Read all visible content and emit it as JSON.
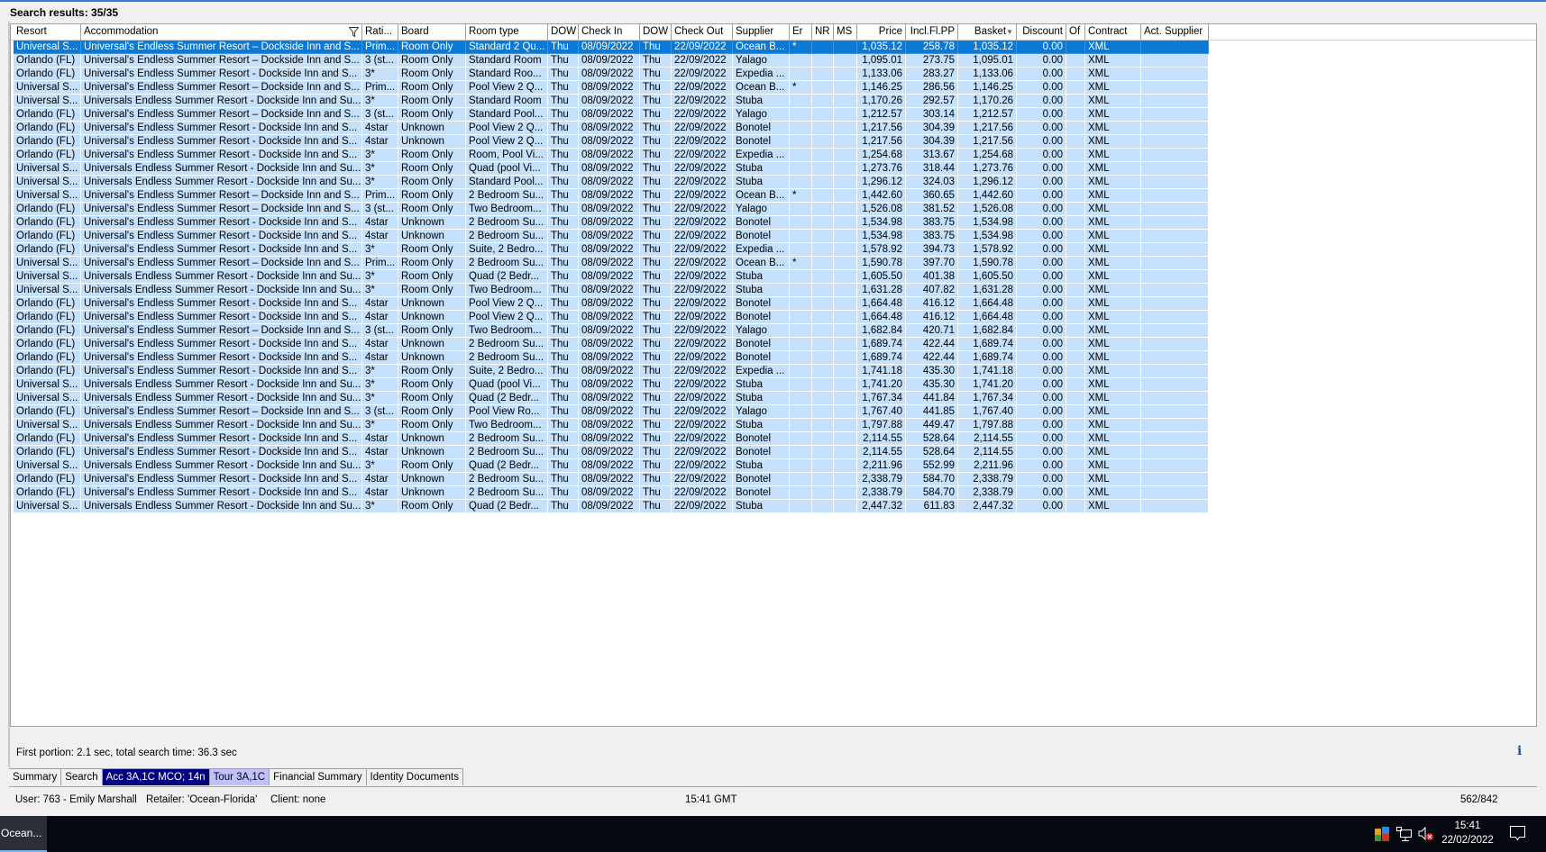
{
  "title": "Search results: 35/35",
  "columns": [
    "Resort",
    "Accommodation",
    "Rati...",
    "Board",
    "Room type",
    "DOW",
    "Check In",
    "DOW",
    "Check Out",
    "Supplier",
    "Er",
    "NR",
    "MS",
    "Price",
    "Incl.Fl.PP",
    "Basket",
    "Discount",
    "Of",
    "Contract",
    "Act. Supplier"
  ],
  "rows": [
    [
      "Universal S...",
      "Universal's Endless Summer Resort – Dockside Inn and S...",
      "Prim...",
      "Room Only",
      "Standard 2 Qu...",
      "Thu",
      "08/09/2022",
      "Thu",
      "22/09/2022",
      "Ocean B...",
      "*",
      "",
      "",
      "1,035.12",
      "258.78",
      "1,035.12",
      "0.00",
      "",
      "XML",
      ""
    ],
    [
      "Orlando (FL)",
      "Universal's Endless Summer Resort – Dockside Inn and S...",
      "3 (st...",
      "Room Only",
      "Standard Room",
      "Thu",
      "08/09/2022",
      "Thu",
      "22/09/2022",
      "Yalago",
      "",
      "",
      "",
      "1,095.01",
      "273.75",
      "1,095.01",
      "0.00",
      "",
      "XML",
      ""
    ],
    [
      "Orlando (FL)",
      "Universal's Endless Summer Resort - Dockside Inn and S...",
      "3*",
      "Room Only",
      "Standard Roo...",
      "Thu",
      "08/09/2022",
      "Thu",
      "22/09/2022",
      "Expedia ...",
      "",
      "",
      "",
      "1,133.06",
      "283.27",
      "1,133.06",
      "0.00",
      "",
      "XML",
      ""
    ],
    [
      "Universal S...",
      "Universal's Endless Summer Resort – Dockside Inn and S...",
      "Prim...",
      "Room Only",
      "Pool View 2 Q...",
      "Thu",
      "08/09/2022",
      "Thu",
      "22/09/2022",
      "Ocean B...",
      "*",
      "",
      "",
      "1,146.25",
      "286.56",
      "1,146.25",
      "0.00",
      "",
      "XML",
      ""
    ],
    [
      "Universal S...",
      "Universals Endless Summer Resort - Dockside Inn and Su...",
      "3*",
      "Room Only",
      "Standard Room",
      "Thu",
      "08/09/2022",
      "Thu",
      "22/09/2022",
      "Stuba",
      "",
      "",
      "",
      "1,170.26",
      "292.57",
      "1,170.26",
      "0.00",
      "",
      "XML",
      ""
    ],
    [
      "Orlando (FL)",
      "Universal's Endless Summer Resort – Dockside Inn and S...",
      "3 (st...",
      "Room Only",
      "Standard Pool...",
      "Thu",
      "08/09/2022",
      "Thu",
      "22/09/2022",
      "Yalago",
      "",
      "",
      "",
      "1,212.57",
      "303.14",
      "1,212.57",
      "0.00",
      "",
      "XML",
      ""
    ],
    [
      "Orlando (FL)",
      "Universal's Endless Summer Resort - Dockside Inn and S...",
      "4star",
      "Unknown",
      "Pool View 2 Q...",
      "Thu",
      "08/09/2022",
      "Thu",
      "22/09/2022",
      "Bonotel",
      "",
      "",
      "",
      "1,217.56",
      "304.39",
      "1,217.56",
      "0.00",
      "",
      "XML",
      ""
    ],
    [
      "Orlando (FL)",
      "Universal's Endless Summer Resort - Dockside Inn and S...",
      "4star",
      "Unknown",
      "Pool View 2 Q...",
      "Thu",
      "08/09/2022",
      "Thu",
      "22/09/2022",
      "Bonotel",
      "",
      "",
      "",
      "1,217.56",
      "304.39",
      "1,217.56",
      "0.00",
      "",
      "XML",
      ""
    ],
    [
      "Orlando (FL)",
      "Universal's Endless Summer Resort - Dockside Inn and S...",
      "3*",
      "Room Only",
      "Room, Pool Vi...",
      "Thu",
      "08/09/2022",
      "Thu",
      "22/09/2022",
      "Expedia ...",
      "",
      "",
      "",
      "1,254.68",
      "313.67",
      "1,254.68",
      "0.00",
      "",
      "XML",
      ""
    ],
    [
      "Universal S...",
      "Universals Endless Summer Resort - Dockside Inn and Su...",
      "3*",
      "Room Only",
      "Quad (pool Vi...",
      "Thu",
      "08/09/2022",
      "Thu",
      "22/09/2022",
      "Stuba",
      "",
      "",
      "",
      "1,273.76",
      "318.44",
      "1,273.76",
      "0.00",
      "",
      "XML",
      ""
    ],
    [
      "Universal S...",
      "Universals Endless Summer Resort - Dockside Inn and Su...",
      "3*",
      "Room Only",
      "Standard Pool...",
      "Thu",
      "08/09/2022",
      "Thu",
      "22/09/2022",
      "Stuba",
      "",
      "",
      "",
      "1,296.12",
      "324.03",
      "1,296.12",
      "0.00",
      "",
      "XML",
      ""
    ],
    [
      "Universal S...",
      "Universal's Endless Summer Resort – Dockside Inn and S...",
      "Prim...",
      "Room Only",
      "2 Bedroom Su...",
      "Thu",
      "08/09/2022",
      "Thu",
      "22/09/2022",
      "Ocean B...",
      "*",
      "",
      "",
      "1,442.60",
      "360.65",
      "1,442.60",
      "0.00",
      "",
      "XML",
      ""
    ],
    [
      "Orlando (FL)",
      "Universal's Endless Summer Resort – Dockside Inn and S...",
      "3 (st...",
      "Room Only",
      "Two Bedroom...",
      "Thu",
      "08/09/2022",
      "Thu",
      "22/09/2022",
      "Yalago",
      "",
      "",
      "",
      "1,526.08",
      "381.52",
      "1,526.08",
      "0.00",
      "",
      "XML",
      ""
    ],
    [
      "Orlando (FL)",
      "Universal's Endless Summer Resort - Dockside Inn and S...",
      "4star",
      "Unknown",
      "2 Bedroom Su...",
      "Thu",
      "08/09/2022",
      "Thu",
      "22/09/2022",
      "Bonotel",
      "",
      "",
      "",
      "1,534.98",
      "383.75",
      "1,534.98",
      "0.00",
      "",
      "XML",
      ""
    ],
    [
      "Orlando (FL)",
      "Universal's Endless Summer Resort - Dockside Inn and S...",
      "4star",
      "Unknown",
      "2 Bedroom Su...",
      "Thu",
      "08/09/2022",
      "Thu",
      "22/09/2022",
      "Bonotel",
      "",
      "",
      "",
      "1,534.98",
      "383.75",
      "1,534.98",
      "0.00",
      "",
      "XML",
      ""
    ],
    [
      "Orlando (FL)",
      "Universal's Endless Summer Resort - Dockside Inn and S...",
      "3*",
      "Room Only",
      "Suite, 2 Bedro...",
      "Thu",
      "08/09/2022",
      "Thu",
      "22/09/2022",
      "Expedia ...",
      "",
      "",
      "",
      "1,578.92",
      "394.73",
      "1,578.92",
      "0.00",
      "",
      "XML",
      ""
    ],
    [
      "Universal S...",
      "Universal's Endless Summer Resort – Dockside Inn and S...",
      "Prim...",
      "Room Only",
      "2 Bedroom Su...",
      "Thu",
      "08/09/2022",
      "Thu",
      "22/09/2022",
      "Ocean B...",
      "*",
      "",
      "",
      "1,590.78",
      "397.70",
      "1,590.78",
      "0.00",
      "",
      "XML",
      ""
    ],
    [
      "Universal S...",
      "Universals Endless Summer Resort - Dockside Inn and Su...",
      "3*",
      "Room Only",
      "Quad (2 Bedr...",
      "Thu",
      "08/09/2022",
      "Thu",
      "22/09/2022",
      "Stuba",
      "",
      "",
      "",
      "1,605.50",
      "401.38",
      "1,605.50",
      "0.00",
      "",
      "XML",
      ""
    ],
    [
      "Universal S...",
      "Universals Endless Summer Resort - Dockside Inn and Su...",
      "3*",
      "Room Only",
      "Two Bedroom...",
      "Thu",
      "08/09/2022",
      "Thu",
      "22/09/2022",
      "Stuba",
      "",
      "",
      "",
      "1,631.28",
      "407.82",
      "1,631.28",
      "0.00",
      "",
      "XML",
      ""
    ],
    [
      "Orlando (FL)",
      "Universal's Endless Summer Resort - Dockside Inn and S...",
      "4star",
      "Unknown",
      "Pool View 2 Q...",
      "Thu",
      "08/09/2022",
      "Thu",
      "22/09/2022",
      "Bonotel",
      "",
      "",
      "",
      "1,664.48",
      "416.12",
      "1,664.48",
      "0.00",
      "",
      "XML",
      ""
    ],
    [
      "Orlando (FL)",
      "Universal's Endless Summer Resort - Dockside Inn and S...",
      "4star",
      "Unknown",
      "Pool View 2 Q...",
      "Thu",
      "08/09/2022",
      "Thu",
      "22/09/2022",
      "Bonotel",
      "",
      "",
      "",
      "1,664.48",
      "416.12",
      "1,664.48",
      "0.00",
      "",
      "XML",
      ""
    ],
    [
      "Orlando (FL)",
      "Universal's Endless Summer Resort – Dockside Inn and S...",
      "3 (st...",
      "Room Only",
      "Two Bedroom...",
      "Thu",
      "08/09/2022",
      "Thu",
      "22/09/2022",
      "Yalago",
      "",
      "",
      "",
      "1,682.84",
      "420.71",
      "1,682.84",
      "0.00",
      "",
      "XML",
      ""
    ],
    [
      "Orlando (FL)",
      "Universal's Endless Summer Resort - Dockside Inn and S...",
      "4star",
      "Unknown",
      "2 Bedroom Su...",
      "Thu",
      "08/09/2022",
      "Thu",
      "22/09/2022",
      "Bonotel",
      "",
      "",
      "",
      "1,689.74",
      "422.44",
      "1,689.74",
      "0.00",
      "",
      "XML",
      ""
    ],
    [
      "Orlando (FL)",
      "Universal's Endless Summer Resort - Dockside Inn and S...",
      "4star",
      "Unknown",
      "2 Bedroom Su...",
      "Thu",
      "08/09/2022",
      "Thu",
      "22/09/2022",
      "Bonotel",
      "",
      "",
      "",
      "1,689.74",
      "422.44",
      "1,689.74",
      "0.00",
      "",
      "XML",
      ""
    ],
    [
      "Orlando (FL)",
      "Universal's Endless Summer Resort - Dockside Inn and S...",
      "3*",
      "Room Only",
      "Suite, 2 Bedro...",
      "Thu",
      "08/09/2022",
      "Thu",
      "22/09/2022",
      "Expedia ...",
      "",
      "",
      "",
      "1,741.18",
      "435.30",
      "1,741.18",
      "0.00",
      "",
      "XML",
      ""
    ],
    [
      "Universal S...",
      "Universals Endless Summer Resort - Dockside Inn and Su...",
      "3*",
      "Room Only",
      "Quad (pool Vi...",
      "Thu",
      "08/09/2022",
      "Thu",
      "22/09/2022",
      "Stuba",
      "",
      "",
      "",
      "1,741.20",
      "435.30",
      "1,741.20",
      "0.00",
      "",
      "XML",
      ""
    ],
    [
      "Universal S...",
      "Universals Endless Summer Resort - Dockside Inn and Su...",
      "3*",
      "Room Only",
      "Quad (2 Bedr...",
      "Thu",
      "08/09/2022",
      "Thu",
      "22/09/2022",
      "Stuba",
      "",
      "",
      "",
      "1,767.34",
      "441.84",
      "1,767.34",
      "0.00",
      "",
      "XML",
      ""
    ],
    [
      "Orlando (FL)",
      "Universal's Endless Summer Resort – Dockside Inn and S...",
      "3 (st...",
      "Room Only",
      "Pool View Ro...",
      "Thu",
      "08/09/2022",
      "Thu",
      "22/09/2022",
      "Yalago",
      "",
      "",
      "",
      "1,767.40",
      "441.85",
      "1,767.40",
      "0.00",
      "",
      "XML",
      ""
    ],
    [
      "Universal S...",
      "Universals Endless Summer Resort - Dockside Inn and Su...",
      "3*",
      "Room Only",
      "Two Bedroom...",
      "Thu",
      "08/09/2022",
      "Thu",
      "22/09/2022",
      "Stuba",
      "",
      "",
      "",
      "1,797.88",
      "449.47",
      "1,797.88",
      "0.00",
      "",
      "XML",
      ""
    ],
    [
      "Orlando (FL)",
      "Universal's Endless Summer Resort - Dockside Inn and S...",
      "4star",
      "Unknown",
      "2 Bedroom Su...",
      "Thu",
      "08/09/2022",
      "Thu",
      "22/09/2022",
      "Bonotel",
      "",
      "",
      "",
      "2,114.55",
      "528.64",
      "2,114.55",
      "0.00",
      "",
      "XML",
      ""
    ],
    [
      "Orlando (FL)",
      "Universal's Endless Summer Resort - Dockside Inn and S...",
      "4star",
      "Unknown",
      "2 Bedroom Su...",
      "Thu",
      "08/09/2022",
      "Thu",
      "22/09/2022",
      "Bonotel",
      "",
      "",
      "",
      "2,114.55",
      "528.64",
      "2,114.55",
      "0.00",
      "",
      "XML",
      ""
    ],
    [
      "Universal S...",
      "Universals Endless Summer Resort - Dockside Inn and Su...",
      "3*",
      "Room Only",
      "Quad (2 Bedr...",
      "Thu",
      "08/09/2022",
      "Thu",
      "22/09/2022",
      "Stuba",
      "",
      "",
      "",
      "2,211.96",
      "552.99",
      "2,211.96",
      "0.00",
      "",
      "XML",
      ""
    ],
    [
      "Orlando (FL)",
      "Universal's Endless Summer Resort - Dockside Inn and S...",
      "4star",
      "Unknown",
      "2 Bedroom Su...",
      "Thu",
      "08/09/2022",
      "Thu",
      "22/09/2022",
      "Bonotel",
      "",
      "",
      "",
      "2,338.79",
      "584.70",
      "2,338.79",
      "0.00",
      "",
      "XML",
      ""
    ],
    [
      "Orlando (FL)",
      "Universal's Endless Summer Resort - Dockside Inn and S...",
      "4star",
      "Unknown",
      "2 Bedroom Su...",
      "Thu",
      "08/09/2022",
      "Thu",
      "22/09/2022",
      "Bonotel",
      "",
      "",
      "",
      "2,338.79",
      "584.70",
      "2,338.79",
      "0.00",
      "",
      "XML",
      ""
    ],
    [
      "Universal S...",
      "Universals Endless Summer Resort - Dockside Inn and Su...",
      "3*",
      "Room Only",
      "Quad (2 Bedr...",
      "Thu",
      "08/09/2022",
      "Thu",
      "22/09/2022",
      "Stuba",
      "",
      "",
      "",
      "2,447.32",
      "611.83",
      "2,447.32",
      "0.00",
      "",
      "XML",
      ""
    ]
  ],
  "selected_row": 0,
  "status": "First portion: 2.1 sec, total search time: 36.3 sec",
  "tabs": [
    "Summary",
    "Search",
    "Acc 3A,1C MCO; 14n",
    "Tour 3A,1C",
    "Financial Summary",
    "Identity Documents"
  ],
  "statusbar": {
    "user": "User: 763 - Emily Marshall",
    "retailer": "Retailer: 'Ocean-Florida'",
    "client": "Client: none",
    "time": "15:41 GMT",
    "counter": "562/842"
  },
  "taskbar": {
    "app": "Ocean...",
    "clock_time": "15:41",
    "clock_date": "22/02/2022"
  },
  "colors": {
    "selected": "#0a7ad6",
    "row": "#c4e0fb",
    "active_tab": "#000080",
    "secondary_tab": "#c0c0ff"
  }
}
